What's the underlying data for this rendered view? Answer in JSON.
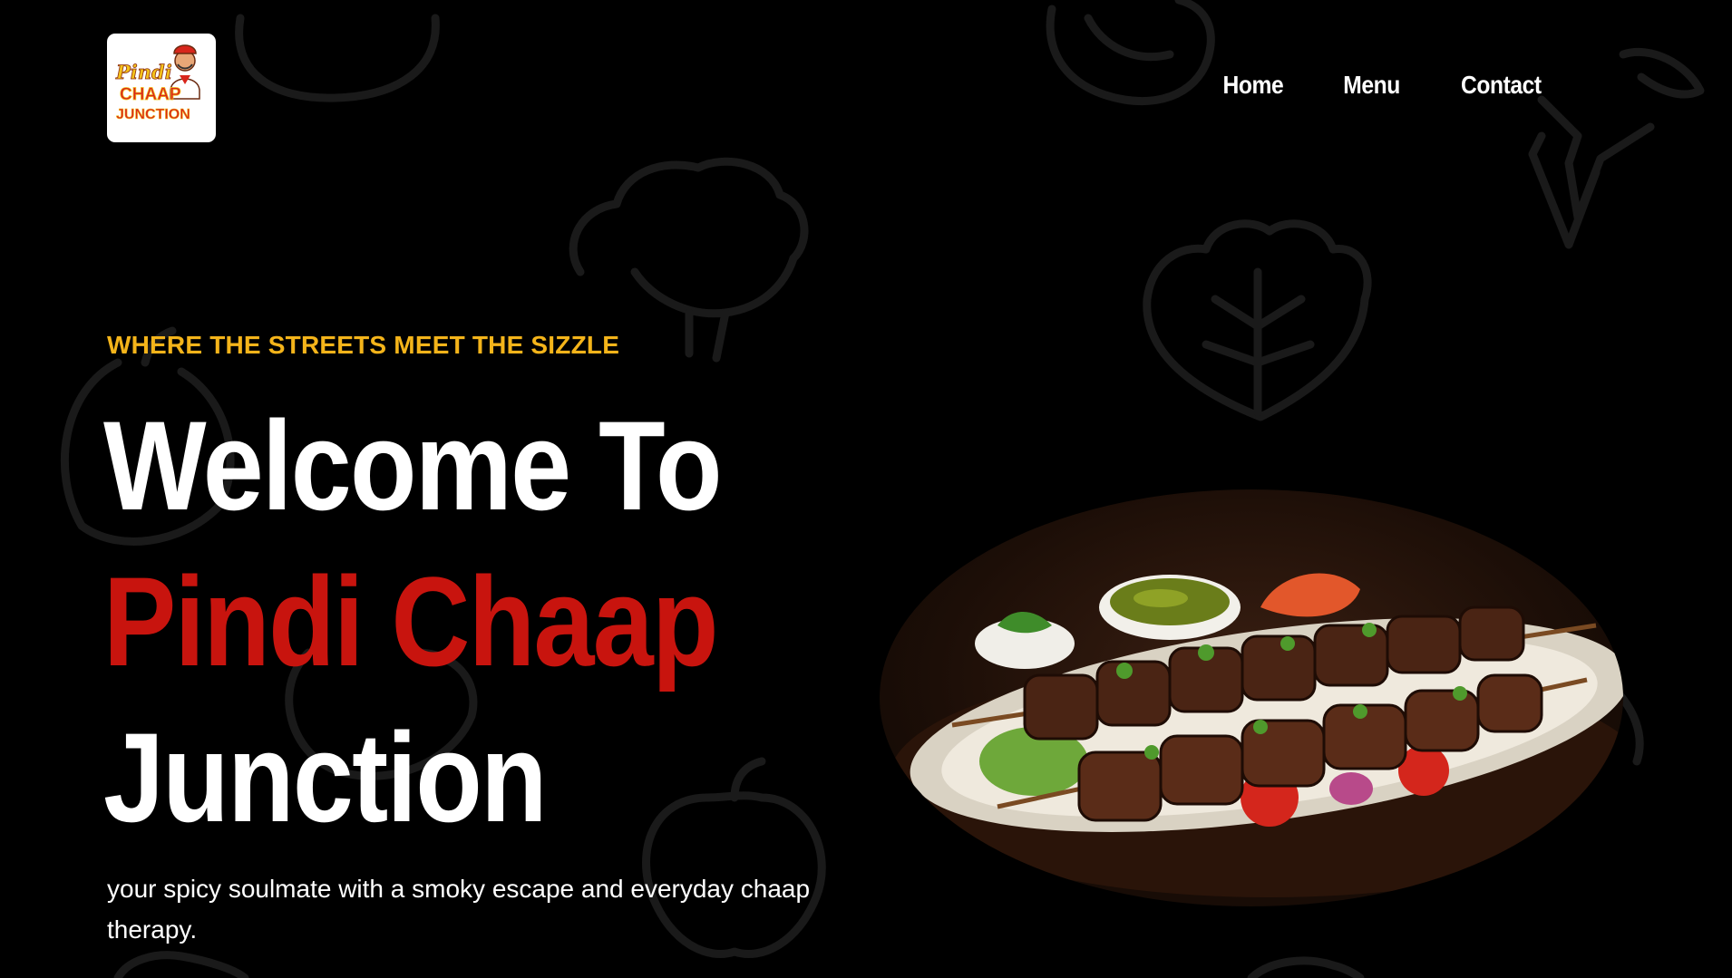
{
  "logo": {
    "line1": "Pindi",
    "line2": "CHAAP",
    "line3": "JUNCTION"
  },
  "nav": {
    "items": [
      {
        "label": "Home"
      },
      {
        "label": "Menu"
      },
      {
        "label": "Contact"
      }
    ]
  },
  "hero": {
    "tagline": "WHERE THE STREETS MEET THE SIZZLE",
    "headline_line1": "Welcome To",
    "headline_line2": "Pindi Chaap",
    "headline_line3": "Junction",
    "description": "your spicy soulmate with a smoky escape and everyday chaap therapy."
  },
  "colors": {
    "background": "#000000",
    "accent_yellow": "#f4b41a",
    "accent_red": "#c8140e",
    "text": "#ffffff"
  },
  "icons": [
    "logo-chef-icon",
    "background-veggie-doodles",
    "kebab-platter-image"
  ]
}
